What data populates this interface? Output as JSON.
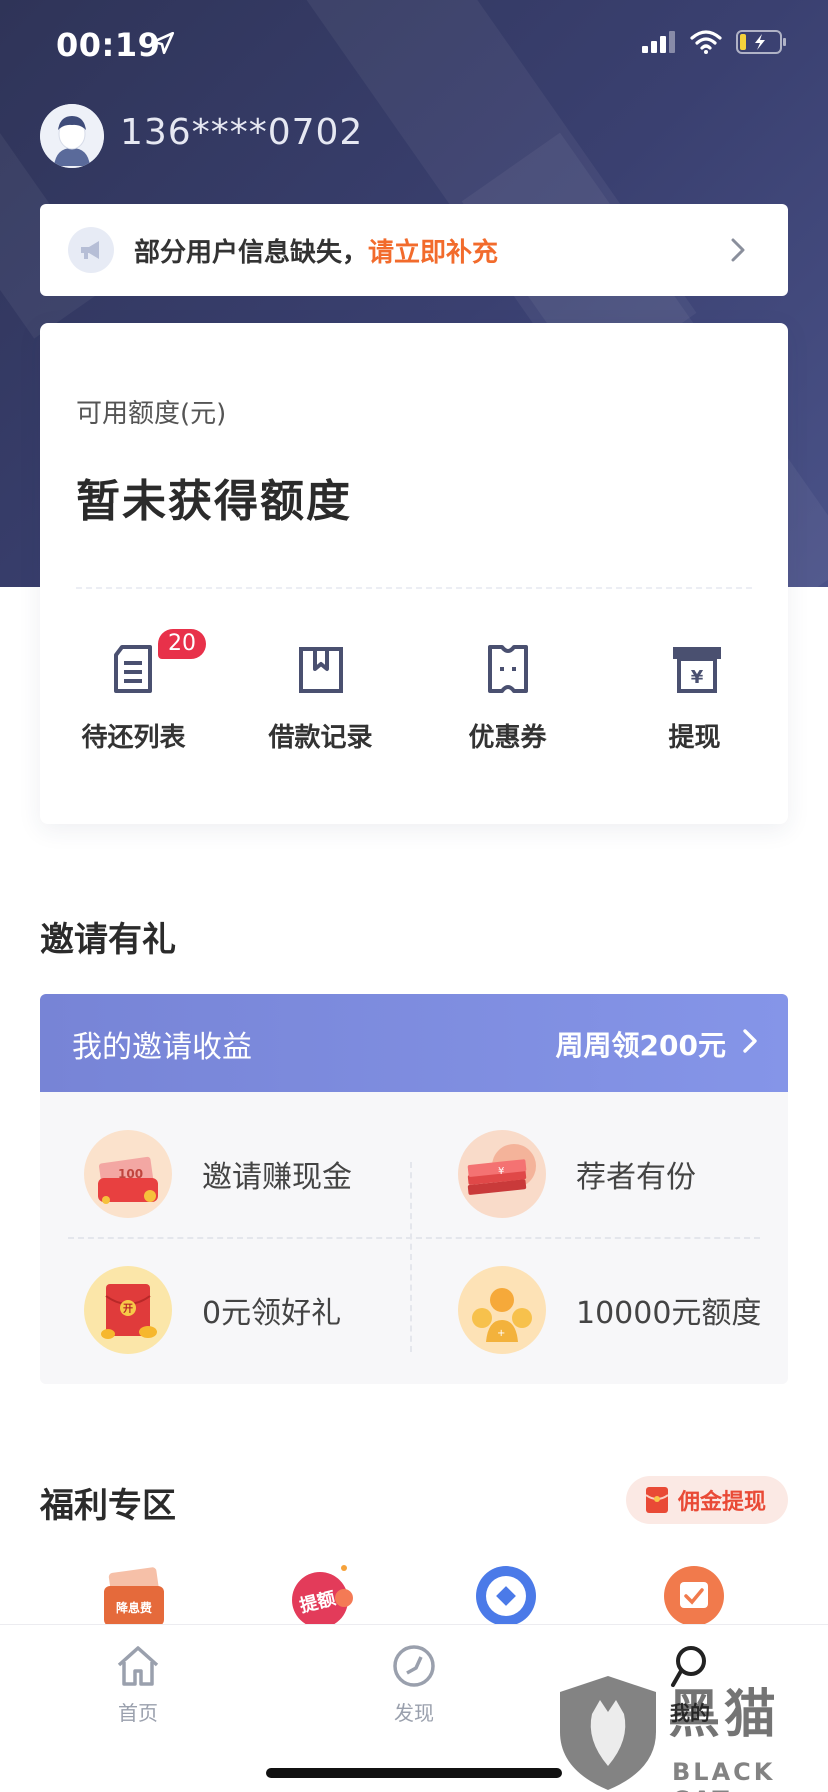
{
  "status_bar": {
    "time": "00:19"
  },
  "user": {
    "phone": "136****0702"
  },
  "notice": {
    "text": "部分用户信息缺失，",
    "link": "请立即补充"
  },
  "credit": {
    "label": "可用额度(元)",
    "value": "暂未获得额度"
  },
  "menu": [
    {
      "label": "待还列表",
      "icon": "bill-list-icon",
      "badge": "20"
    },
    {
      "label": "借款记录",
      "icon": "bookmark-record-icon"
    },
    {
      "label": "优惠券",
      "icon": "coupon-icon"
    },
    {
      "label": "提现",
      "icon": "withdraw-yen-icon"
    }
  ],
  "invite": {
    "section_title": "邀请有礼",
    "header_title": "我的邀请收益",
    "header_link": "周周领200元",
    "items": [
      {
        "label": "邀请赚现金",
        "icon": "cash-envelope-icon"
      },
      {
        "label": "荐者有份",
        "icon": "money-stack-icon"
      },
      {
        "label": "0元领好礼",
        "icon": "red-packet-icon"
      },
      {
        "label": "10000元额度",
        "icon": "user-coins-icon"
      }
    ]
  },
  "benefits": {
    "section_title": "福利专区",
    "badge": "佣金提现",
    "icons": [
      "rate-discount-icon",
      "raise-limit-icon",
      "blue-circle-icon",
      "calendar-check-icon"
    ],
    "icon_labels": [
      "降息费",
      "提额"
    ]
  },
  "tabs": [
    {
      "label": "首页",
      "icon": "home-icon",
      "active": false
    },
    {
      "label": "发现",
      "icon": "compass-icon",
      "active": false
    },
    {
      "label": "我的",
      "icon": "profile-icon",
      "active": true
    }
  ],
  "watermark": {
    "cn": "黑猫",
    "en": "BLACK CAT"
  },
  "colors": {
    "accent_orange": "#f26b2c",
    "hero_bg": "#343a62",
    "invite_header": "#7d8ae0",
    "badge_red": "#e8314a"
  }
}
